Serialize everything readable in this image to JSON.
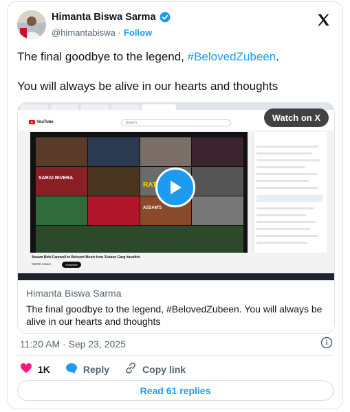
{
  "author": {
    "name": "Himanta Biswa Sarma",
    "handle": "@himantabiswa",
    "separator": "·",
    "follow_label": "Follow",
    "verified": true
  },
  "x_logo": "x-logo-icon",
  "tweet": {
    "line1_text": "The final goodbye to the legend, ",
    "line1_hashtag": "#BelovedZubeen",
    "line1_end": ".",
    "line2_text": "You will always be alive in our hearts and thoughts"
  },
  "media": {
    "watch_label": "Watch on X",
    "play_icon": "play-icon",
    "screenshot": {
      "youtube_logo_text": "YouTube",
      "search_placeholder": "Search",
      "video_title": "Assam Bids Farewell to Beloved Music Icon Zubeen Garg #asufirb",
      "channel": "NEWS Assam",
      "subscribe_label": "Subscribe",
      "tile_text_1": "SARAI RIVERA",
      "tile_text_2": "RATE",
      "tile_text_3": "ASSAM'S"
    }
  },
  "card": {
    "source_name": "Himanta Biswa Sarma",
    "text": "The final goodbye to the legend, #BelovedZubeen. You will always be alive in our hearts and thoughts"
  },
  "timestamp": "11:20 AM · Sep 23, 2025",
  "actions": {
    "likes": "1K",
    "reply_label": "Reply",
    "copy_label": "Copy link"
  },
  "read_replies_label": "Read 61 replies",
  "colors": {
    "accent": "#1d9bf0",
    "like": "#f91880",
    "text": "#0f1419",
    "muted": "#536471"
  }
}
